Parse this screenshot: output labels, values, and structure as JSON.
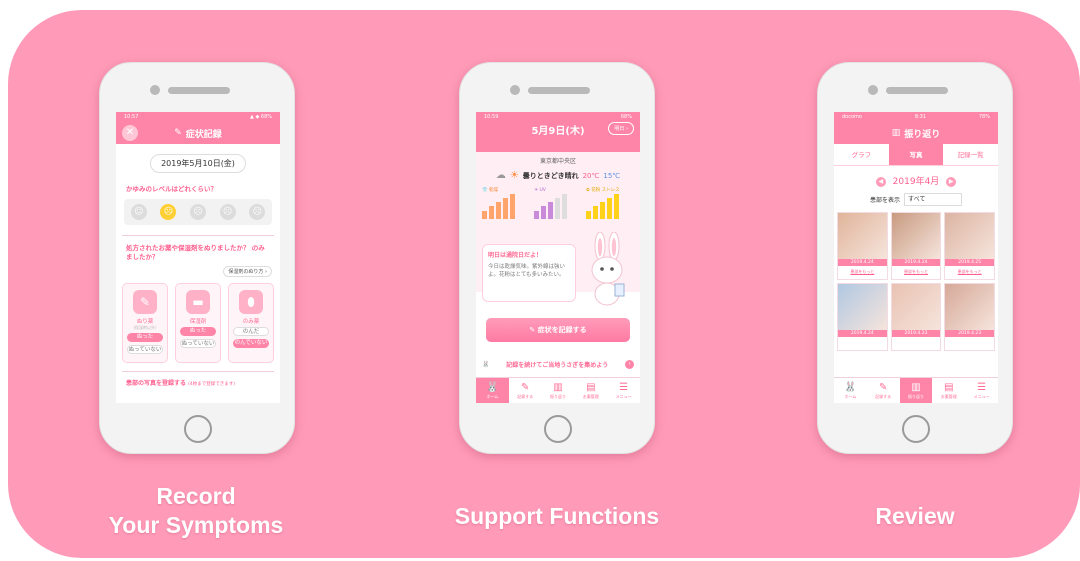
{
  "captions": {
    "record_line1": "Record",
    "record_line2": "Your Symptoms",
    "support": "Support Functions",
    "review": "Review"
  },
  "phone1": {
    "status_time": "10:57",
    "status_right": "▲ ◆ 68%",
    "title": "症状記録",
    "date": "2019年5月10日(金)",
    "itch_question": "かゆみのレベルはどれくらい？",
    "itch_level_selected": 2,
    "meds_question": "処方されたお薬や保湿剤をぬりましたか？ のみましたか？",
    "howto_label": "保湿剤のぬり方",
    "cards": [
      {
        "label": "ぬり薬",
        "sub": "(保湿剤以外)",
        "btn1": "ぬった",
        "btn2": "ぬっていない",
        "icon": "ointment-icon"
      },
      {
        "label": "保湿剤",
        "sub": "",
        "btn1": "ぬった",
        "btn2": "ぬっていない",
        "icon": "moisturizer-icon"
      },
      {
        "label": "のみ薬",
        "sub": "",
        "btn1": "のんだ",
        "btn2": "のんでいない",
        "icon": "capsule-icon"
      }
    ],
    "photo_prompt": "患部の写真を登録する",
    "photo_note": "(4枚まで登録できます)"
  },
  "phone2": {
    "status_time": "10:59",
    "status_right": "68%",
    "date": "5月9日(木)",
    "tomorrow": "明日",
    "location": "東京都中央区",
    "weather": "曇りときどき晴れ",
    "temp_high": "20℃",
    "temp_low": "15℃",
    "indices": [
      "乾燥",
      "UV",
      "花粉 ストレス"
    ],
    "message_title": "明日は通院日だよ！",
    "message_body": "今日は乾燥気味。紫外線は強いよ。花粉はとても多いみたい。",
    "record_button": "症状を記録する",
    "collect_text": "記録を続けてご当地うさぎを集めよう",
    "tabs": [
      "ホーム",
      "記録する",
      "振り返り",
      "お薬管理",
      "メニュー"
    ]
  },
  "phone3": {
    "status_left": "docomo",
    "status_time": "8:31",
    "status_right": "78%",
    "title": "振り返り",
    "tabs": [
      "グラフ",
      "写真",
      "記録一覧"
    ],
    "month": "2019年4月",
    "filter_label": "患部を表示",
    "filter_value": "すべて",
    "photos": [
      {
        "date": "2019.4.24",
        "link": "患部をもっと",
        "tone": "#e0b49a"
      },
      {
        "date": "2019.4.24",
        "link": "患部をもっと",
        "tone": "#c89a80"
      },
      {
        "date": "2019.4.25",
        "link": "患部をもっと",
        "tone": "#dcb4a2"
      },
      {
        "date": "2019.4.24",
        "link": "",
        "tone": "#b0c8e2"
      },
      {
        "date": "2019.4.23",
        "link": "",
        "tone": "#e8c2b2"
      },
      {
        "date": "2019.4.23",
        "link": "",
        "tone": "#d6a898"
      }
    ],
    "bottom_tabs": [
      "ホーム",
      "記録する",
      "振り返り",
      "お薬管理",
      "メニュー"
    ]
  },
  "colors": {
    "stage": "#ff9bb8",
    "accent": "#ff85a8",
    "accent_dark": "#ff5f8f"
  }
}
